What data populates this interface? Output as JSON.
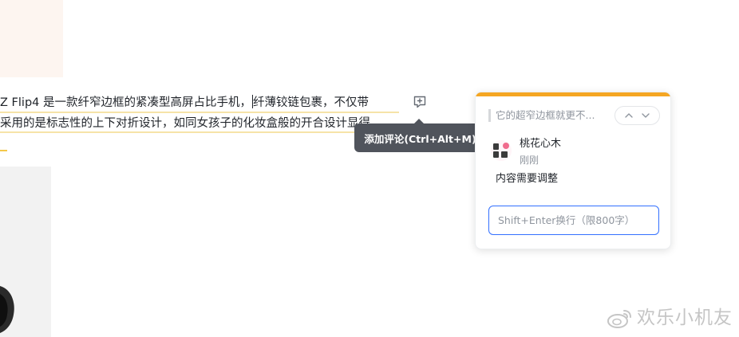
{
  "document": {
    "line1_part1": "Z Flip4 是一款纤窄边框的紧凑型高屏占比手机，",
    "line1_part2": "纤薄铰链包裹，不仅带",
    "line2": "采用的是标志性的上下对折设计，如同女孩子的化妆盒般的开合设计显得"
  },
  "comment_button": {
    "icon": "add-comment-icon",
    "tooltip": "添加评论(Ctrl+Alt+M)"
  },
  "comment_panel": {
    "accent_color": "#f5a623",
    "quote": "它的超窄边框就更不...",
    "nav": {
      "prev_icon": "chevron-up-icon",
      "next_icon": "chevron-down-icon"
    },
    "comment": {
      "avatar_icon": "peach-blossom-avatar",
      "user": "桃花心木",
      "time": "刚刚",
      "text": "内容需要调整"
    },
    "reply_placeholder": "Shift+Enter换行（限800字）",
    "input_border_color": "#3370ff"
  },
  "watermark": {
    "icon": "weibo-icon",
    "text": "欢乐小机友"
  }
}
